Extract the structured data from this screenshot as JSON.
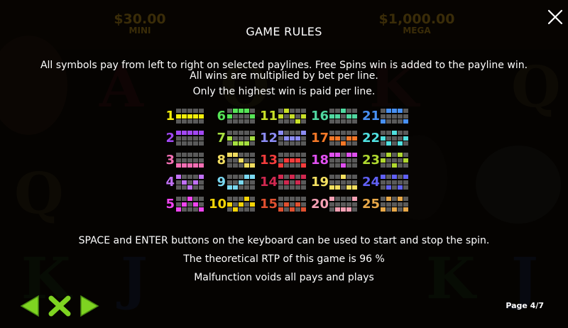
{
  "header": {
    "title": "GAME RULES",
    "jackpots": [
      {
        "amount": "$30.00",
        "name": "MINI"
      },
      {
        "amount": "$1,000.00",
        "name": "MEGA"
      }
    ]
  },
  "rules": {
    "line1": "All symbols pay from left to right on selected paylines. Free Spins win is added to the payline win.",
    "line2": "All wins are multiplied by bet per line.",
    "line3": "Only the highest win is paid per line.",
    "line4": "SPACE and ENTER buttons on the keyboard can be used to start and stop the spin.",
    "line5": "The theoretical RTP of this game is 96 %",
    "line6": "Malfunction voids all pays and plays"
  },
  "paylines": [
    {
      "number": "1",
      "color": "#f4ef0a",
      "rows": [
        1,
        1,
        1,
        1,
        1
      ]
    },
    {
      "number": "2",
      "color": "#a248f4",
      "rows": [
        0,
        0,
        0,
        0,
        0
      ]
    },
    {
      "number": "3",
      "color": "#f46fb4",
      "rows": [
        2,
        2,
        2,
        2,
        2
      ]
    },
    {
      "number": "4",
      "color": "#c070f4",
      "rows": [
        0,
        1,
        2,
        1,
        0
      ]
    },
    {
      "number": "5",
      "color": "#f044f0",
      "rows": [
        2,
        1,
        0,
        1,
        2
      ]
    },
    {
      "number": "6",
      "color": "#56e456",
      "rows": [
        1,
        0,
        0,
        0,
        1
      ]
    },
    {
      "number": "7",
      "color": "#a6e040",
      "rows": [
        1,
        2,
        2,
        2,
        1
      ]
    },
    {
      "number": "8",
      "color": "#f0dc60",
      "rows": [
        0,
        0,
        1,
        2,
        2
      ]
    },
    {
      "number": "9",
      "color": "#7ad8f0",
      "rows": [
        2,
        2,
        1,
        0,
        0
      ]
    },
    {
      "number": "10",
      "color": "#f4d408",
      "rows": [
        1,
        2,
        1,
        0,
        1
      ]
    },
    {
      "number": "11",
      "color": "#c8e028",
      "rows": [
        1,
        0,
        1,
        2,
        1
      ]
    },
    {
      "number": "12",
      "color": "#8c8cf4",
      "rows": [
        0,
        1,
        1,
        1,
        0
      ]
    },
    {
      "number": "13",
      "color": "#f43c3c",
      "rows": [
        2,
        1,
        1,
        1,
        2
      ]
    },
    {
      "number": "14",
      "color": "#d02850",
      "rows": [
        0,
        1,
        0,
        1,
        0
      ]
    },
    {
      "number": "15",
      "color": "#e05030",
      "rows": [
        2,
        1,
        2,
        1,
        2
      ]
    },
    {
      "number": "16",
      "color": "#50d8a0",
      "rows": [
        1,
        1,
        0,
        1,
        1
      ]
    },
    {
      "number": "17",
      "color": "#f47828",
      "rows": [
        1,
        1,
        2,
        1,
        1
      ]
    },
    {
      "number": "18",
      "color": "#e050f0",
      "rows": [
        0,
        0,
        2,
        0,
        0
      ]
    },
    {
      "number": "19",
      "color": "#f4e060",
      "rows": [
        2,
        2,
        0,
        2,
        2
      ]
    },
    {
      "number": "20",
      "color": "#f4a0b4",
      "rows": [
        0,
        2,
        2,
        2,
        0
      ]
    },
    {
      "number": "21",
      "color": "#4890f4",
      "rows": [
        2,
        0,
        0,
        0,
        2
      ]
    },
    {
      "number": "22",
      "color": "#50e0e0",
      "rows": [
        1,
        2,
        0,
        2,
        1
      ]
    },
    {
      "number": "23",
      "color": "#b0d830",
      "rows": [
        1,
        0,
        2,
        0,
        1
      ]
    },
    {
      "number": "24",
      "color": "#6060f4",
      "rows": [
        0,
        2,
        0,
        2,
        0
      ]
    },
    {
      "number": "25",
      "color": "#e8a848",
      "rows": [
        2,
        0,
        2,
        0,
        2
      ]
    }
  ],
  "footer": {
    "page_label": "Page 4/7"
  },
  "colors": {
    "nav_green": "#7ed321",
    "cell_inactive": "#5a5a5a"
  }
}
